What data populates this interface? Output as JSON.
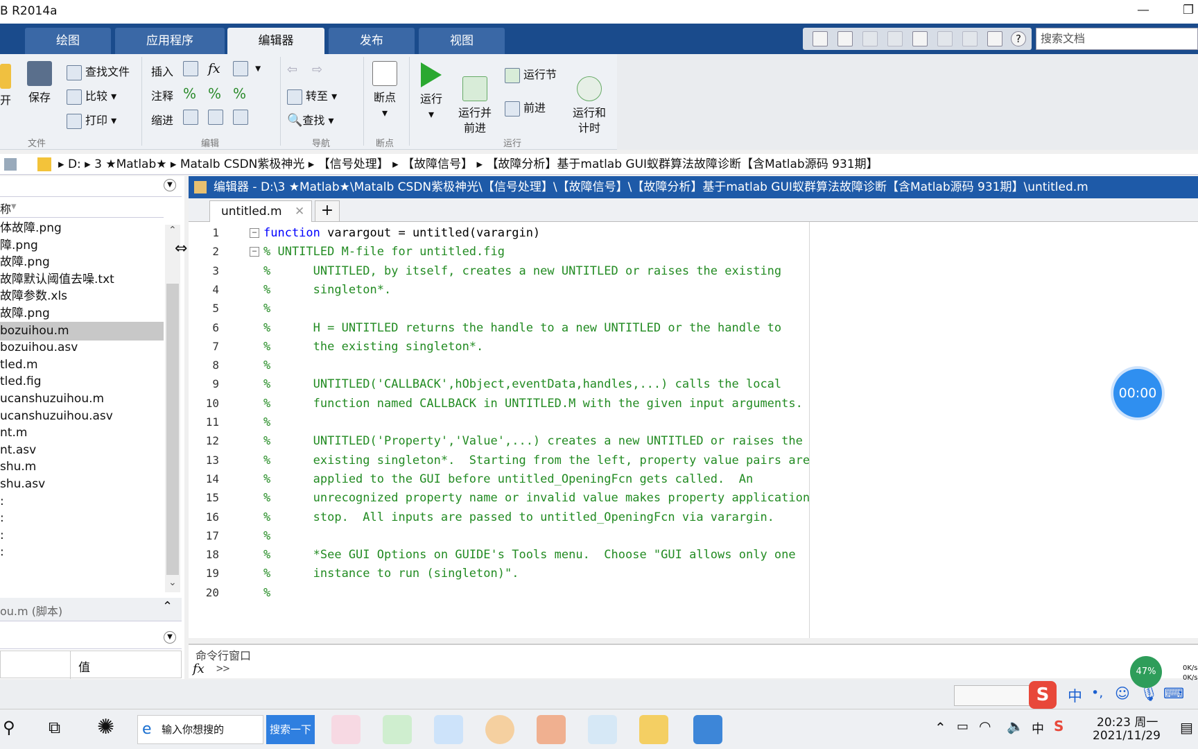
{
  "window": {
    "title": "B R2014a"
  },
  "tabs": [
    "绘图",
    "应用程序",
    "编辑器",
    "发布",
    "视图"
  ],
  "search_placeholder": "搜索文档",
  "ribbon": {
    "file": {
      "open": "开",
      "save": "保存",
      "find_files": "查找文件",
      "compare": "比较",
      "print": "打印",
      "label": "文件"
    },
    "edit": {
      "insert": "插入",
      "comment": "注释",
      "indent": "缩进",
      "fx": "fx",
      "label": "编辑"
    },
    "nav": {
      "goto": "转至",
      "find": "查找",
      "label": "导航"
    },
    "breakpoints": {
      "btn": "断点",
      "label": "断点"
    },
    "run": {
      "run": "运行",
      "run_advance": "运行并\n前进",
      "run_section": "运行节",
      "advance": "前进",
      "run_time": "运行和\n计时",
      "label": "运行"
    }
  },
  "address": {
    "crumbs": [
      "D:",
      "3 ★Matlab★",
      "Matalb CSDN紫极神光",
      "【信号处理】",
      "【故障信号】",
      "【故障分析】基于matlab GUI蚁群算法故障诊断【含Matlab源码 931期】"
    ]
  },
  "left_panel": {
    "header": "称",
    "files": [
      "体故障.png",
      "障.png",
      "故障.png",
      "故障默认阈值去噪.txt",
      "故障参数.xls",
      "故障.png",
      "bozuihou.m",
      "bozuihou.asv",
      "tled.m",
      "tled.fig",
      "ucanshuzuihou.m",
      "ucanshuzuihou.asv",
      "nt.m",
      "nt.asv",
      "shu.m",
      "shu.asv"
    ],
    "selected_index": 6,
    "details": "ou.m (脚本)",
    "workspace_col": "值"
  },
  "editor": {
    "title": "编辑器 - D:\\3 ★Matlab★\\Matalb CSDN紫极神光\\【信号处理】\\【故障信号】\\【故障分析】基于matlab GUI蚁群算法故障诊断【含Matlab源码 931期】\\untitled.m",
    "tab": "untitled.m",
    "lines": [
      "function varargout = untitled(varargin)",
      "% UNTITLED M-file for untitled.fig",
      "%      UNTITLED, by itself, creates a new UNTITLED or raises the existing",
      "%      singleton*.",
      "%",
      "%      H = UNTITLED returns the handle to a new UNTITLED or the handle to",
      "%      the existing singleton*.",
      "%",
      "%      UNTITLED('CALLBACK',hObject,eventData,handles,...) calls the local",
      "%      function named CALLBACK in UNTITLED.M with the given input arguments.",
      "%",
      "%      UNTITLED('Property','Value',...) creates a new UNTITLED or raises the",
      "%      existing singleton*.  Starting from the left, property value pairs are",
      "%      applied to the GUI before untitled_OpeningFcn gets called.  An",
      "%      unrecognized property name or invalid value makes property application",
      "%      stop.  All inputs are passed to untitled_OpeningFcn via varargin.",
      "%",
      "%      *See GUI Options on GUIDE's Tools menu.  Choose \"GUI allows only one",
      "%      instance to run (singleton)\".",
      "%"
    ]
  },
  "timer": "00:00",
  "command_window": {
    "title": "命令行窗口",
    "prompt": ">>",
    "fx": "fx"
  },
  "taskbar": {
    "search_text": "输入你想搜的",
    "search_btn": "搜索一下",
    "clock_time": "20:23 周一",
    "clock_date": "2021/11/29",
    "ime_lang": "中",
    "tray_lang": "中",
    "net_percent": "47%",
    "net_up": "0K/s",
    "net_down": "0K/s"
  },
  "colors": {
    "ribbon_blue": "#1a4b8c",
    "editor_title": "#1e5aa8",
    "comment_green": "#228b22",
    "keyword_blue": "#0000ff"
  }
}
